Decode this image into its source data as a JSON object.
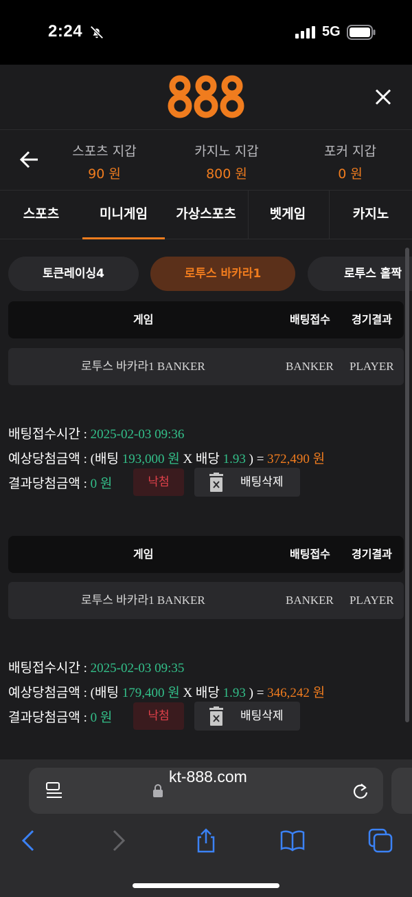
{
  "status_bar": {
    "time": "2:24",
    "network": "5G"
  },
  "header": {
    "logo_text": "888",
    "brand_color": "#f07c1e"
  },
  "wallets": [
    {
      "label": "스포츠 지갑",
      "value": "90 원"
    },
    {
      "label": "카지노 지갑",
      "value": "800 원"
    },
    {
      "label": "포커 지갑",
      "value": "0 원"
    }
  ],
  "tabs": [
    {
      "label": "스포츠"
    },
    {
      "label": "미니게임",
      "active": true
    },
    {
      "label": "가상스포츠"
    },
    {
      "label": "벳게임"
    },
    {
      "label": "카지노"
    }
  ],
  "game_pills": [
    {
      "label": "토큰레이싱4"
    },
    {
      "label": "로투스 바카라1",
      "active": true
    },
    {
      "label": "로투스 홀짝"
    }
  ],
  "table_header": {
    "game": "게임",
    "bet": "배팅접수",
    "result": "경기결과"
  },
  "bets": [
    {
      "game": "로투스 바카라1 BANKER",
      "bet_pick": "BANKER",
      "result": "PLAYER",
      "time_label": "배팅접수시간 :",
      "time": "2025-02-03 09:36",
      "expected_label": "예상당첨금액 : (배팅",
      "bet_amount": "193,000 원",
      "x_odds_label": "X 배당",
      "odds": "1.93",
      "close_eq": ") =",
      "expected_win": "372,490 원",
      "actual_label": "결과당첨금액 :",
      "actual_win": "0 원",
      "status": "낙첨",
      "delete_label": "배팅삭제"
    },
    {
      "game": "로투스 바카라1 BANKER",
      "bet_pick": "BANKER",
      "result": "PLAYER",
      "time_label": "배팅접수시간 :",
      "time": "2025-02-03 09:35",
      "expected_label": "예상당첨금액 : (배팅",
      "bet_amount": "179,400 원",
      "x_odds_label": "X 배당",
      "odds": "1.93",
      "close_eq": ") =",
      "expected_win": "346,242 원",
      "actual_label": "결과당첨금액 :",
      "actual_win": "0 원",
      "status": "낙첨",
      "delete_label": "배팅삭제"
    }
  ],
  "browser": {
    "url": "kt-888.com"
  },
  "icons": [
    "bell-slash-icon",
    "signal-icon",
    "battery-icon",
    "close-icon",
    "back-arrow-icon",
    "trash-icon",
    "reader-icon",
    "lock-icon",
    "reload-icon",
    "nav-back-icon",
    "nav-forward-icon",
    "share-icon",
    "bookmarks-icon",
    "tabs-icon"
  ]
}
